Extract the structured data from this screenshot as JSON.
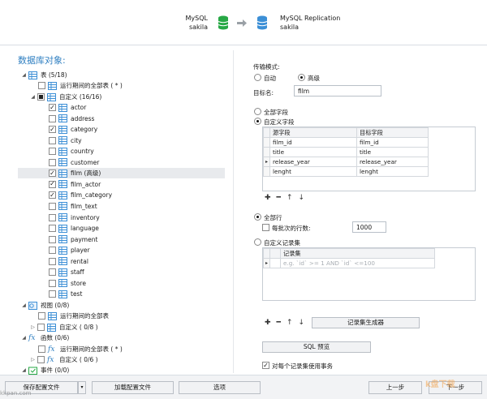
{
  "header": {
    "source_db": "MySQL",
    "source_name": "sakila",
    "target_db": "MySQL Replication",
    "target_name": "sakila",
    "source_color": "#27a845",
    "target_color": "#3c8fd6"
  },
  "section_title": "数据库对象:",
  "tree": {
    "tables": {
      "label": "表 (5/18)"
    },
    "tables_runtime_all": "运行期间的全部表 ( * )",
    "tables_custom": "自定义 (16/16)",
    "tables_items": [
      {
        "label": "actor",
        "checked": true
      },
      {
        "label": "address",
        "checked": false
      },
      {
        "label": "category",
        "checked": true
      },
      {
        "label": "city",
        "checked": false
      },
      {
        "label": "country",
        "checked": false
      },
      {
        "label": "customer",
        "checked": false
      },
      {
        "label": "film (高级)",
        "checked": true,
        "selected": true
      },
      {
        "label": "film_actor",
        "checked": true
      },
      {
        "label": "film_category",
        "checked": true
      },
      {
        "label": "film_text",
        "checked": false
      },
      {
        "label": "inventory",
        "checked": false
      },
      {
        "label": "language",
        "checked": false
      },
      {
        "label": "payment",
        "checked": false
      },
      {
        "label": "player",
        "checked": false
      },
      {
        "label": "rental",
        "checked": false
      },
      {
        "label": "staff",
        "checked": false
      },
      {
        "label": "store",
        "checked": false
      },
      {
        "label": "test",
        "checked": false
      }
    ],
    "views": "视图 (0/8)",
    "views_runtime_all": "运行期间的全部表",
    "views_custom": "自定义 ( 0/8 )",
    "functions": "函数 (0/6)",
    "functions_runtime_all": "运行期间的全部表 ( * )",
    "functions_custom": "自定义 ( 0/6 )",
    "events": "事件 (0/0)"
  },
  "right": {
    "transfer_mode_label": "传输模式:",
    "mode_auto": "自动",
    "mode_advanced": "高级",
    "target_name_label": "目标名:",
    "target_name_value": "film",
    "all_fields": "全部字段",
    "custom_fields": "自定义字段",
    "field_headers": [
      "源字段",
      "目标字段"
    ],
    "field_rows": [
      [
        "film_id",
        "film_id"
      ],
      [
        "title",
        "title"
      ],
      [
        "release_year",
        "release_year"
      ],
      [
        "lenght",
        "lenght"
      ]
    ],
    "all_rows": "全部行",
    "batch_rows_label": "每批次的行数:",
    "batch_rows_value": "1000",
    "custom_recordset": "自定义记录集",
    "recordset_header": "记录集",
    "recordset_placeholder": "e.g. `id` >= 1 AND `id` <=100",
    "recordset_generator": "记录集生成器",
    "sql_preview": "SQL 预览",
    "use_transaction": "对每个记录集使用事务"
  },
  "footer": {
    "save_profile": "保存配置文件",
    "load_profile": "加载配置文件",
    "options": "选项",
    "back": "上一步",
    "next": "下一步"
  },
  "watermark_left": "kkpan.com",
  "watermark_right": "k盘下载"
}
